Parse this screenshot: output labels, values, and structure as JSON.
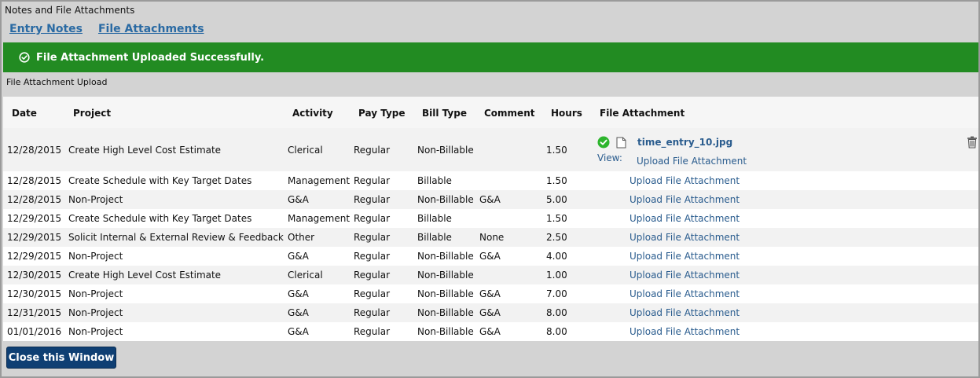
{
  "window": {
    "title": "Notes and File Attachments"
  },
  "tabs": [
    {
      "label": "Entry Notes"
    },
    {
      "label": "File Attachments"
    }
  ],
  "banner": {
    "text": "File Attachment Uploaded Successfully.",
    "icon": "check-circle-icon",
    "color": "#228b22"
  },
  "section": {
    "label": "File Attachment Upload"
  },
  "table": {
    "headers": [
      "Date",
      "Project",
      "Activity",
      "Pay Type",
      "Bill Type",
      "Comment",
      "Hours",
      "File Attachment"
    ],
    "rows": [
      {
        "date": "12/28/2015",
        "project": "Create High Level Cost Estimate",
        "activity": "Clerical",
        "pay_type": "Regular",
        "bill_type": "Non-Billable",
        "comment": "",
        "hours": "1.50",
        "view_label": "View:",
        "file_name": "time_entry_10.jpg",
        "upload": "Upload File Attachment"
      },
      {
        "date": "12/28/2015",
        "project": "Create Schedule with Key Target Dates",
        "activity": "Management",
        "pay_type": "Regular",
        "bill_type": "Billable",
        "comment": "",
        "hours": "1.50",
        "upload": "Upload File Attachment"
      },
      {
        "date": "12/28/2015",
        "project": "Non-Project",
        "activity": "G&A",
        "pay_type": "Regular",
        "bill_type": "Non-Billable",
        "comment": "G&A",
        "hours": "5.00",
        "upload": "Upload File Attachment"
      },
      {
        "date": "12/29/2015",
        "project": "Create Schedule with Key Target Dates",
        "activity": "Management",
        "pay_type": "Regular",
        "bill_type": "Billable",
        "comment": "",
        "hours": "1.50",
        "upload": "Upload File Attachment"
      },
      {
        "date": "12/29/2015",
        "project": "Solicit Internal & External Review & Feedback",
        "activity": "Other",
        "pay_type": "Regular",
        "bill_type": "Billable",
        "comment": "None",
        "hours": "2.50",
        "upload": "Upload File Attachment"
      },
      {
        "date": "12/29/2015",
        "project": "Non-Project",
        "activity": "G&A",
        "pay_type": "Regular",
        "bill_type": "Non-Billable",
        "comment": "G&A",
        "hours": "4.00",
        "upload": "Upload File Attachment"
      },
      {
        "date": "12/30/2015",
        "project": "Create High Level Cost Estimate",
        "activity": "Clerical",
        "pay_type": "Regular",
        "bill_type": "Non-Billable",
        "comment": "",
        "hours": "1.00",
        "upload": "Upload File Attachment"
      },
      {
        "date": "12/30/2015",
        "project": "Non-Project",
        "activity": "G&A",
        "pay_type": "Regular",
        "bill_type": "Non-Billable",
        "comment": "G&A",
        "hours": "7.00",
        "upload": "Upload File Attachment"
      },
      {
        "date": "12/31/2015",
        "project": "Non-Project",
        "activity": "G&A",
        "pay_type": "Regular",
        "bill_type": "Non-Billable",
        "comment": "G&A",
        "hours": "8.00",
        "upload": "Upload File Attachment"
      },
      {
        "date": "01/01/2016",
        "project": "Non-Project",
        "activity": "G&A",
        "pay_type": "Regular",
        "bill_type": "Non-Billable",
        "comment": "G&A",
        "hours": "8.00",
        "upload": "Upload File Attachment"
      }
    ]
  },
  "footer": {
    "close_label": "Close this Window"
  }
}
